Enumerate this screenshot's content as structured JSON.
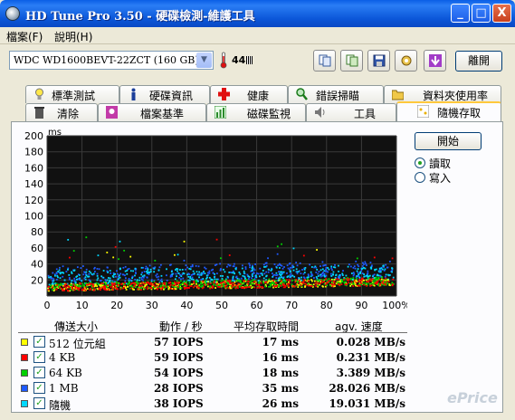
{
  "window": {
    "title": "HD Tune Pro 3.50 - 硬碟檢測-維護工具",
    "minimize": "_",
    "maximize": "□",
    "close": "X"
  },
  "menu": [
    "檔案(F)",
    "說明(H)"
  ],
  "toolbar": {
    "drive": "WDC WD1600BEVT-22ZCT (160 GB)",
    "temperature": "44",
    "exit_label": "離開",
    "icons": [
      "copy-text-icon",
      "copy-screenshot-icon",
      "save-icon",
      "options-icon",
      "download-icon"
    ]
  },
  "tabs_row1": [
    "標準測試",
    "硬碟資訊",
    "健康",
    "錯誤掃瞄",
    "資料夾使用率"
  ],
  "tabs_row2": [
    "清除",
    "檔案基準",
    "磁碟監視",
    "工具",
    "隨機存取"
  ],
  "active_tab": "隨機存取",
  "controls": {
    "start_label": "開始",
    "read_label": "讀取",
    "write_label": "寫入",
    "selected": "read"
  },
  "results": {
    "headers": [
      "傳送大小",
      "動作 / 秒",
      "平均存取時間",
      "agv. 速度"
    ],
    "rows": [
      {
        "label": "512 位元組",
        "iops": "57 IOPS",
        "access": "17 ms",
        "speed": "0.028 MB/s",
        "color": "#ffff00"
      },
      {
        "label": "4 KB",
        "iops": "59 IOPS",
        "access": "16 ms",
        "speed": "0.231 MB/s",
        "color": "#ff0000"
      },
      {
        "label": "64 KB",
        "iops": "54 IOPS",
        "access": "18 ms",
        "speed": "3.389 MB/s",
        "color": "#00d000"
      },
      {
        "label": "1 MB",
        "iops": "28 IOPS",
        "access": "35 ms",
        "speed": "28.026 MB/s",
        "color": "#1e5aff"
      },
      {
        "label": "隨機",
        "iops": "38 IOPS",
        "access": "26 ms",
        "speed": "19.031 MB/s",
        "color": "#00d8ff"
      }
    ]
  },
  "chart_data": {
    "type": "scatter",
    "ylabel": "ms",
    "ylim": [
      0,
      200
    ],
    "xlim": [
      0,
      100
    ],
    "yticks": [
      "200",
      "180",
      "160",
      "140",
      "120",
      "100",
      "80",
      "60",
      "40",
      "20"
    ],
    "xticks": [
      "0",
      "10",
      "20",
      "30",
      "40",
      "50",
      "60",
      "70",
      "80",
      "90",
      "100%"
    ],
    "grid": true,
    "series": [
      {
        "name": "512 位元組",
        "color": "#ffff00",
        "band_start": [
          7,
          16
        ],
        "band_end": [
          14,
          23
        ]
      },
      {
        "name": "4 KB",
        "color": "#ff0000",
        "band_start": [
          7,
          16
        ],
        "band_end": [
          14,
          24
        ]
      },
      {
        "name": "64 KB",
        "color": "#00d000",
        "band_start": [
          8,
          17
        ],
        "band_end": [
          15,
          25
        ]
      },
      {
        "name": "1 MB",
        "color": "#1e5aff",
        "band_start": [
          18,
          38
        ],
        "band_end": [
          25,
          45
        ]
      },
      {
        "name": "隨機",
        "color": "#00d8ff",
        "band_start": [
          15,
          35
        ],
        "band_end": [
          22,
          40
        ]
      }
    ]
  },
  "watermark": "ePrice"
}
